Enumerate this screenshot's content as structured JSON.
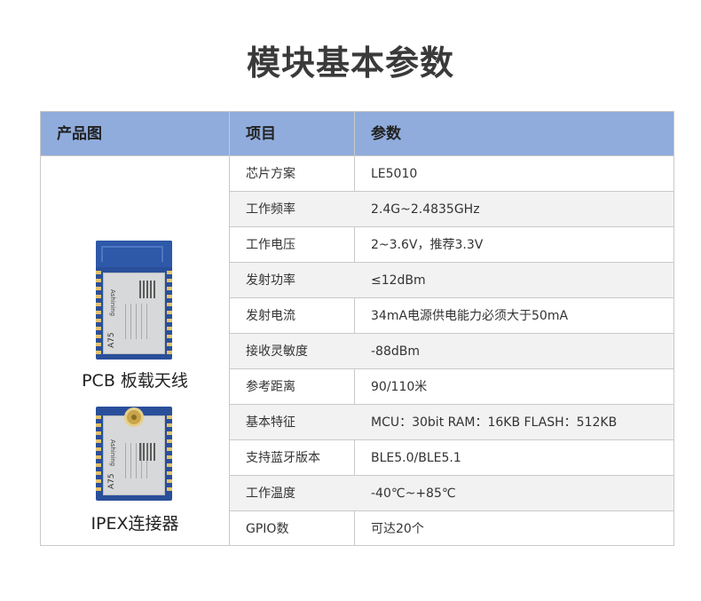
{
  "title": "模块基本参数",
  "table": {
    "headers": {
      "product": "产品图",
      "item": "项目",
      "param": "参数"
    },
    "products": [
      {
        "label": "PCB 板载天线",
        "module_brand": "Ashining",
        "module_model": "A75"
      },
      {
        "label": "IPEX连接器",
        "module_brand": "Ashining",
        "module_model": "A75"
      }
    ],
    "rows": [
      {
        "item": "芯片方案",
        "value": "LE5010"
      },
      {
        "item": "工作频率",
        "value": "2.4G~2.4835GHz"
      },
      {
        "item": "工作电压",
        "value": "2~3.6V，推荐3.3V"
      },
      {
        "item": "发射功率",
        "value": "≤12dBm"
      },
      {
        "item": "发射电流",
        "value": "34mA电源供电能力必须大于50mA"
      },
      {
        "item": "接收灵敏度",
        "value": "-88dBm"
      },
      {
        "item": "参考距离",
        "value": "90/110米"
      },
      {
        "item": "基本特征",
        "value": "MCU：30bit   RAM：16KB   FLASH：512KB"
      },
      {
        "item": "支持蓝牙版本",
        "value": "BLE5.0/BLE5.1"
      },
      {
        "item": "工作温度",
        "value": "-40℃~+85℃"
      },
      {
        "item": "GPIO数",
        "value": "可达20个"
      }
    ]
  }
}
